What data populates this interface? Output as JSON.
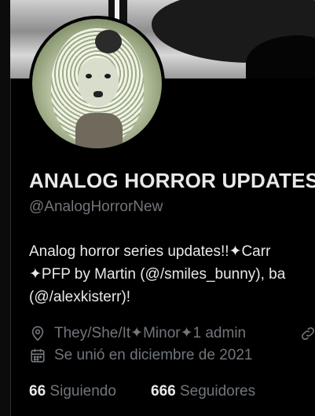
{
  "profile": {
    "display_name": "ANALOG HORROR UPDATES",
    "handle": "@AnalogHorrorNew",
    "bio_lines": [
      "Analog horror series updates!!✦Carr",
      "✦PFP by Martin (@/smiles_bunny), ba",
      "(@/alexkisterr)!"
    ],
    "location": "They/She/It✦Minor✦1 admin",
    "joined": "Se unió en diciembre de 2021",
    "following_count": "66",
    "following_label": "Siguiendo",
    "followers_count": "666",
    "followers_label": "Seguidores"
  },
  "icons": {
    "location": "location-pin-icon",
    "calendar": "calendar-icon",
    "link": "link-icon"
  },
  "colors": {
    "background": "#000000",
    "primary_text": "#e7e9ea",
    "secondary_text": "#71767b"
  }
}
